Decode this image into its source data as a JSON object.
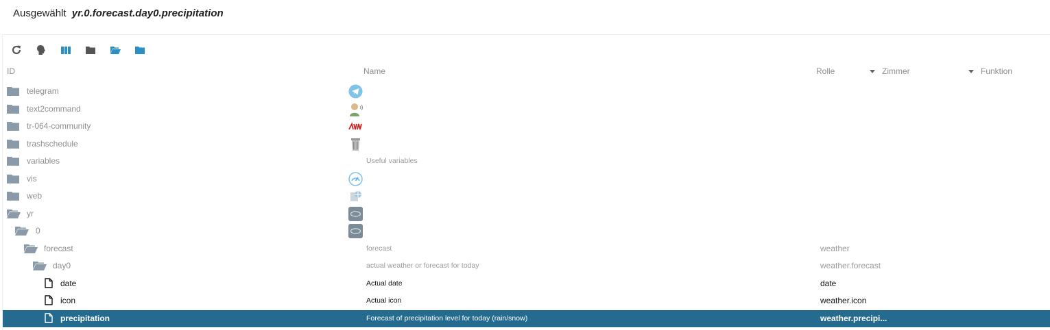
{
  "header": {
    "prefix": "Ausgewählt",
    "selected_path": "yr.0.forecast.day0.precipitation"
  },
  "toolbar": {
    "buttons": [
      {
        "name": "refresh-button",
        "icon": "refresh-icon"
      },
      {
        "name": "expert-mode-button",
        "icon": "head-icon"
      },
      {
        "name": "columns-button",
        "icon": "columns-icon"
      },
      {
        "name": "collapse-all-button",
        "icon": "folder-closed-icon"
      },
      {
        "name": "expand-button",
        "icon": "folder-open-icon"
      },
      {
        "name": "collapse-button",
        "icon": "folder-closed-blue-icon"
      }
    ]
  },
  "columns": {
    "id": "ID",
    "name": "Name",
    "role": "Rolle",
    "room": "Zimmer",
    "function": "Funktion"
  },
  "rows": [
    {
      "id": "telegram",
      "name": "",
      "role": "",
      "type": "folder",
      "icon": "telegram-icon"
    },
    {
      "id": "text2command",
      "name": "",
      "role": "",
      "type": "folder",
      "icon": "person-speaking-icon"
    },
    {
      "id": "tr-064-community",
      "name": "",
      "role": "",
      "type": "folder",
      "icon": "avm-logo-icon"
    },
    {
      "id": "trashschedule",
      "name": "",
      "role": "",
      "type": "folder",
      "icon": "trash-bin-icon"
    },
    {
      "id": "variables",
      "name": "Useful variables",
      "role": "",
      "type": "folder",
      "icon": ""
    },
    {
      "id": "vis",
      "name": "",
      "role": "",
      "type": "folder",
      "icon": "gauge-icon"
    },
    {
      "id": "web",
      "name": "",
      "role": "",
      "type": "folder",
      "icon": "web-server-icon"
    },
    {
      "id": "yr",
      "name": "",
      "role": "",
      "type": "folder-open",
      "icon": "yr-logo-icon"
    },
    {
      "id": "0",
      "name": "",
      "role": "",
      "type": "folder-open",
      "icon": "yr-logo-icon"
    },
    {
      "id": "forecast",
      "name": "forecast",
      "role": "weather",
      "type": "folder-open",
      "icon": ""
    },
    {
      "id": "day0",
      "name": "actual weather or forecast for today",
      "role": "weather.forecast",
      "type": "folder-open",
      "icon": ""
    },
    {
      "id": "date",
      "name": "Actual date",
      "role": "date",
      "type": "file",
      "icon": ""
    },
    {
      "id": "icon",
      "name": "Actual icon",
      "role": "weather.icon",
      "type": "file",
      "icon": ""
    },
    {
      "id": "precipitation",
      "name": "Forecast of precipitation level for today (rain/snow)",
      "role": "weather.precipi...",
      "type": "file",
      "icon": "",
      "selected": true
    }
  ],
  "colors": {
    "selected_row": "#246b8f",
    "folder": "#8a9aa8",
    "accent_blue": "#2a8fc4"
  }
}
